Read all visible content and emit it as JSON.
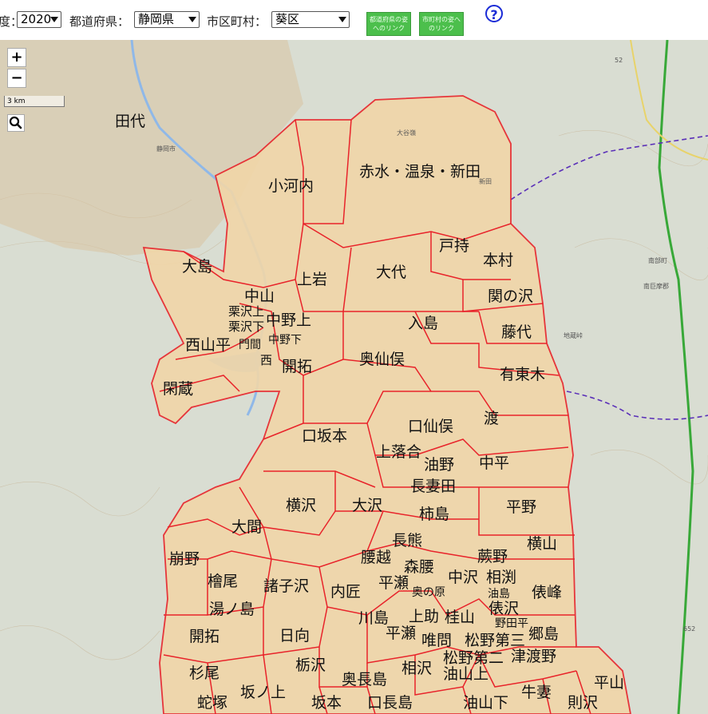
{
  "toolbar": {
    "year_label_fragment": "度：",
    "year_value": "2020",
    "prefecture_label": "都道府県：",
    "prefecture_value": "静岡県",
    "city_label": "市区町村：",
    "city_value": "葵区",
    "link_prefecture": "都道府県の姿へのリンク",
    "link_city": "市町村の姿へのリンク",
    "help_glyph": "?"
  },
  "map": {
    "zoom_in": "+",
    "zoom_out": "−",
    "scale_label": "3 km",
    "search_icon": "magnifier",
    "colors": {
      "district_fill": "#f1d6a8",
      "district_border": "#e8232a",
      "terrain": "#d6dcd1",
      "boundary_dashed": "#5a2fb8",
      "highway": "#38a838",
      "river": "#8fb8e8"
    },
    "districts": [
      "田代",
      "小河内",
      "赤水・温泉・新田",
      "大島",
      "上岩",
      "戸持",
      "本村",
      "大代",
      "中山",
      "関の沢",
      "栗沢上",
      "栗沢下",
      "中野上",
      "入島",
      "藤代",
      "西山平",
      "門間",
      "中野下",
      "西",
      "開拓",
      "奥仙俣",
      "有東木",
      "閑蔵",
      "口仙俣",
      "渡",
      "口坂本",
      "上落合",
      "油野",
      "中平",
      "長妻田",
      "横沢",
      "大沢",
      "平野",
      "大間",
      "柿島",
      "長熊",
      "横山",
      "崩野",
      "腰越",
      "森腰",
      "蕨野",
      "檜尾",
      "諸子沢",
      "内匠",
      "平瀬",
      "中沢",
      "相渕",
      "奥の原",
      "俵峰",
      "湯ノ島",
      "油島",
      "俵沢",
      "上助",
      "川島",
      "桂山",
      "野田平",
      "開拓",
      "日向",
      "平瀬",
      "唯問",
      "松野第三",
      "郷島",
      "杉尾",
      "栃沢",
      "相沢",
      "松野第二",
      "津渡野",
      "奥長島",
      "油山上",
      "平山",
      "坂ノ上",
      "牛妻",
      "蛇塚",
      "坂本",
      "口長島",
      "油山下",
      "則沢"
    ],
    "base_labels": [
      "静岡市",
      "南部町",
      "南巨摩郡",
      "地蔵峠",
      "大谷嶺",
      "新田",
      "52",
      "652"
    ]
  }
}
